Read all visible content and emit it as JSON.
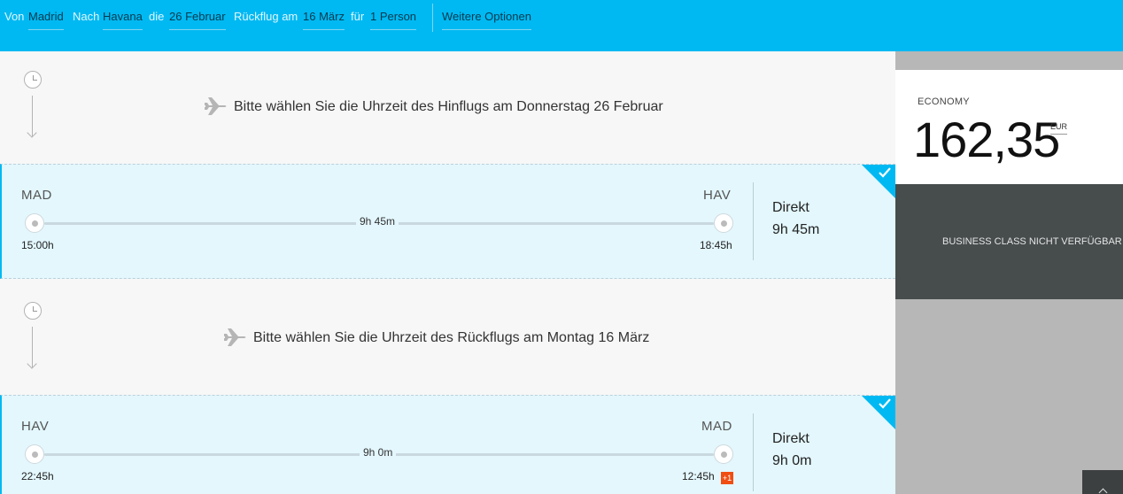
{
  "search": {
    "from_label": "Von",
    "from_value": "Madrid",
    "to_label": "Nach",
    "to_value": "Havana",
    "depart_label": "die",
    "depart_value": "26 Februar",
    "return_label": "Rückflug am",
    "return_value": "16 März",
    "pax_label": "für",
    "pax_value": "1 Person",
    "more_options": "Weitere Optionen"
  },
  "outbound": {
    "prompt": "Bitte wählen Sie die Uhrzeit des Hinflugs am Donnerstag 26 Februar",
    "origin": "MAD",
    "destination": "HAV",
    "duration": "9h 45m",
    "depart_time": "15:00h",
    "arrive_time": "18:45h",
    "stops": "Direkt",
    "total": "9h 45m"
  },
  "inbound": {
    "prompt": "Bitte wählen Sie die Uhrzeit des Rückflugs am Montag 16 März",
    "origin": "HAV",
    "destination": "MAD",
    "duration": "9h 0m",
    "depart_time": "22:45h",
    "arrive_time": "12:45h",
    "day_offset": "+1",
    "stops": "Direkt",
    "total": "9h 0m"
  },
  "fares": {
    "economy_label": "ECONOMY",
    "economy_price": "162,35",
    "currency": "EUR",
    "business_text": "BUSINESS CLASS NICHT VERFÜGBAR"
  },
  "colors": {
    "accent": "#00b9f2",
    "selected_bg": "#e3f7fd",
    "business_bg": "#474c4c",
    "offset_badge": "#f04e12"
  },
  "icons": {
    "clock": "clock-icon",
    "plane": "plane-icon",
    "check": "check-icon",
    "scroll_top": "chevron-up-icon"
  }
}
